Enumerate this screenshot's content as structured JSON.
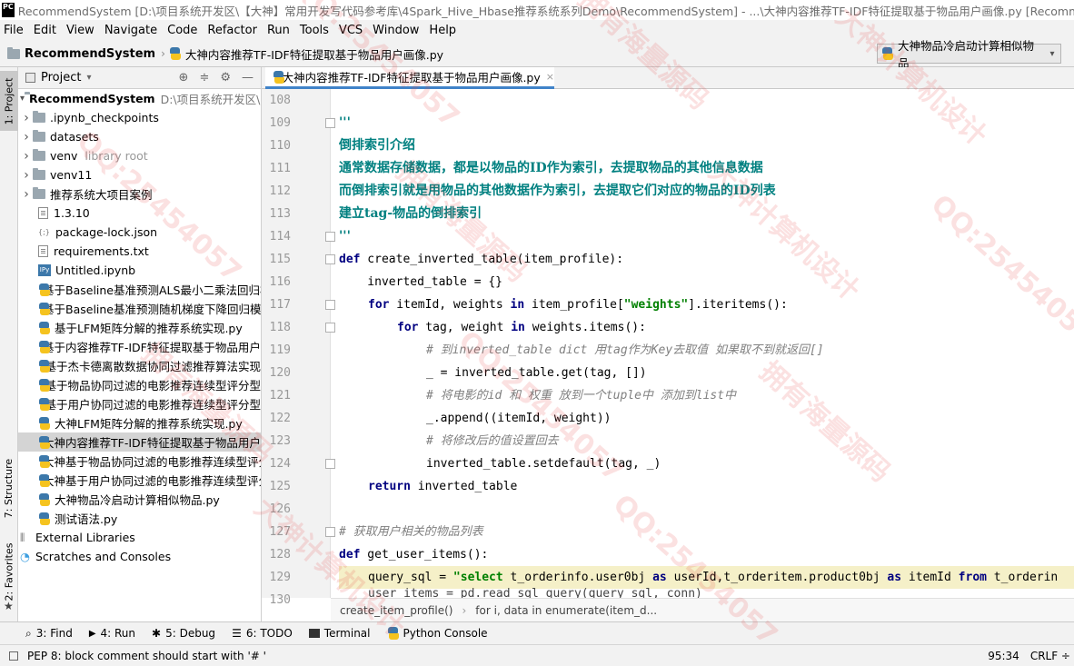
{
  "window": {
    "title": "RecommendSystem [D:\\项目系统开发区\\【大神】常用开发写代码参考库\\4Spark_Hive_Hbase推荐系统系列Demo\\RecommendSystem] - ...\\大神内容推荐TF-IDF特征提取基于物品用户画像.py [RecommendSystem]",
    "app_icon": "PC"
  },
  "menu": [
    "File",
    "Edit",
    "View",
    "Navigate",
    "Code",
    "Refactor",
    "Run",
    "Tools",
    "VCS",
    "Window",
    "Help"
  ],
  "nav": {
    "project": "RecommendSystem",
    "file": "大神内容推荐TF-IDF特征提取基于物品用户画像.py",
    "run_config": "大神物品冷启动计算相似物品"
  },
  "side_tabs": {
    "project": "1: Project",
    "structure": "7: Structure",
    "favorites": "2: Favorites"
  },
  "project_panel": {
    "header": "Project",
    "root": {
      "name": "RecommendSystem",
      "path": "D:\\项目系统开发区\\【大"
    },
    "items": [
      {
        "name": "ipynb_checkpoints",
        "display": ".ipynb_checkpoints",
        "icon": "folder-icon",
        "expandable": true
      },
      {
        "name": "datasets",
        "display": "datasets",
        "icon": "folder-icon",
        "expandable": true
      },
      {
        "name": "venv",
        "display": "venv",
        "icon": "folder-icon",
        "expandable": true,
        "note": "library root"
      },
      {
        "name": "venv11",
        "display": "venv11",
        "icon": "folder-icon",
        "expandable": true
      },
      {
        "name": "cases",
        "display": "推荐系统大项目案例",
        "icon": "folder-icon",
        "expandable": true
      },
      {
        "name": "f1310",
        "display": "1.3.10",
        "icon": "file-icon"
      },
      {
        "name": "pkglock",
        "display": "package-lock.json",
        "icon": "json-icon"
      },
      {
        "name": "req",
        "display": "requirements.txt",
        "icon": "file-icon"
      },
      {
        "name": "untitled",
        "display": "Untitled.ipynb",
        "icon": "ipynb-icon"
      },
      {
        "name": "py1",
        "display": "基于Baseline基准预测ALS最小二乘法回归模型",
        "icon": "python-file-icon"
      },
      {
        "name": "py2",
        "display": "基于Baseline基准预测随机梯度下降回归模型",
        "icon": "python-file-icon"
      },
      {
        "name": "py3",
        "display": "基于LFM矩阵分解的推荐系统实现.py",
        "icon": "python-file-icon"
      },
      {
        "name": "py4",
        "display": "基于内容推荐TF-IDF特征提取基于物品用户画像.py",
        "icon": "python-file-icon"
      },
      {
        "name": "py5",
        "display": "基于杰卡德离散数据协同过滤推荐算法实现",
        "icon": "python-file-icon"
      },
      {
        "name": "py6",
        "display": "基于物品协同过滤的电影推荐连续型评分型",
        "icon": "python-file-icon"
      },
      {
        "name": "py7",
        "display": "基于用户协同过滤的电影推荐连续型评分型",
        "icon": "python-file-icon"
      },
      {
        "name": "py8",
        "display": "大神LFM矩阵分解的推荐系统实现.py",
        "icon": "python-file-icon"
      },
      {
        "name": "py9",
        "display": "大神内容推荐TF-IDF特征提取基于物品用户画像.py",
        "icon": "python-file-icon",
        "selected": true
      },
      {
        "name": "py10",
        "display": "大神基于物品协同过滤的电影推荐连续型评分型",
        "icon": "python-file-icon"
      },
      {
        "name": "py11",
        "display": "大神基于用户协同过滤的电影推荐连续型评分型",
        "icon": "python-file-icon"
      },
      {
        "name": "py12",
        "display": "大神物品冷启动计算相似物品.py",
        "icon": "python-file-icon"
      },
      {
        "name": "py13",
        "display": "测试语法.py",
        "icon": "python-file-icon"
      }
    ],
    "external": "External Libraries",
    "scratches": "Scratches and Consoles"
  },
  "editor": {
    "tab": "大神内容推荐TF-IDF特征提取基于物品用户画像.py",
    "line_numbers": [
      "108",
      "109",
      "110",
      "111",
      "112",
      "113",
      "114",
      "115",
      "116",
      "117",
      "118",
      "119",
      "120",
      "121",
      "122",
      "123",
      "124",
      "125",
      "126",
      "127",
      "128",
      "129",
      "130"
    ],
    "code": {
      "l109": "'''",
      "l110": "倒排索引介绍",
      "l111": "通常数据存储数据，都是以物品的ID作为索引，去提取物品的其他信息数据",
      "l112": "而倒排索引就是用物品的其他数据作为索引，去提取它们对应的物品的ID列表",
      "l113": "建立tag-物品的倒排索引",
      "l114": "'''",
      "l115_kw": "def",
      "l115": " create_inverted_table(item_profile):",
      "l116": "    inverted_table = {}",
      "l117_kw1": "for",
      "l117_a": " itemId, weights ",
      "l117_kw2": "in",
      "l117_b": " item_profile[",
      "l117_str": "\"weights\"",
      "l117_c": "].iteritems():",
      "l118_kw1": "for",
      "l118_a": " tag, weight ",
      "l118_kw2": "in",
      "l118_b": " weights.items():",
      "l119": "# 到inverted_table dict 用tag作为Key去取值 如果取不到就返回[]",
      "l120": "_ = inverted_table.get(tag, [])",
      "l121": "# 将电影的id 和 权重 放到一个tuple中 添加到list中",
      "l122": "_.append((itemId, weight))",
      "l123": "# 将修改后的值设置回去",
      "l124": "inverted_table.setdefault(tag, _)",
      "l125_kw": "return",
      "l125": " inverted_table",
      "l127": "# 获取用户相关的物品列表",
      "l128_kw": "def",
      "l128": " get_user_items():",
      "l129_a": "query_sql = ",
      "l129_str": "\"select",
      "l129_b": " t_orderinfo.user0bj ",
      "l129_kw1": "as",
      "l129_c": " userId,t_orderitem.product0bj ",
      "l129_kw2": "as",
      "l129_d": " itemId ",
      "l129_kw3": "from",
      "l129_e": " t_orderin",
      "l130": "user_items = pd.read_sql_query(query_sql, conn)"
    },
    "breadcrumb": [
      "create_item_profile()",
      "for i, data in enumerate(item_d..."
    ]
  },
  "tool_windows": [
    {
      "key": "3",
      "label": "3: Find",
      "icon": "search-icon"
    },
    {
      "key": "4",
      "label": "4: Run",
      "icon": "play-icon"
    },
    {
      "key": "5",
      "label": "5: Debug",
      "icon": "bug-icon"
    },
    {
      "key": "6",
      "label": "6: TODO",
      "icon": "todo-icon"
    },
    {
      "key": "t",
      "label": "Terminal",
      "icon": "terminal-icon"
    },
    {
      "key": "p",
      "label": "Python Console",
      "icon": "python-icon"
    }
  ],
  "status": {
    "message": "PEP 8: block comment should start with '# '",
    "position": "95:34",
    "line_sep": "CRLF ÷"
  },
  "watermarks": [
    "QQ:25454057",
    "拥有海量源码",
    "大神计算机设计",
    "QQ:25454057",
    "拥有海量源码",
    "大神计算机设计",
    "QQ:25454057",
    "拥有海量源码",
    "QQ:25454057",
    "拥有海量源码",
    "大神计算机设计",
    "QQ:25454057"
  ],
  "colors": {
    "keyword": "#000080",
    "docstring": "#008080",
    "string": "#008000",
    "comment": "#808080",
    "selection": "#d4d4d4",
    "tab_accent": "#4083c9"
  }
}
